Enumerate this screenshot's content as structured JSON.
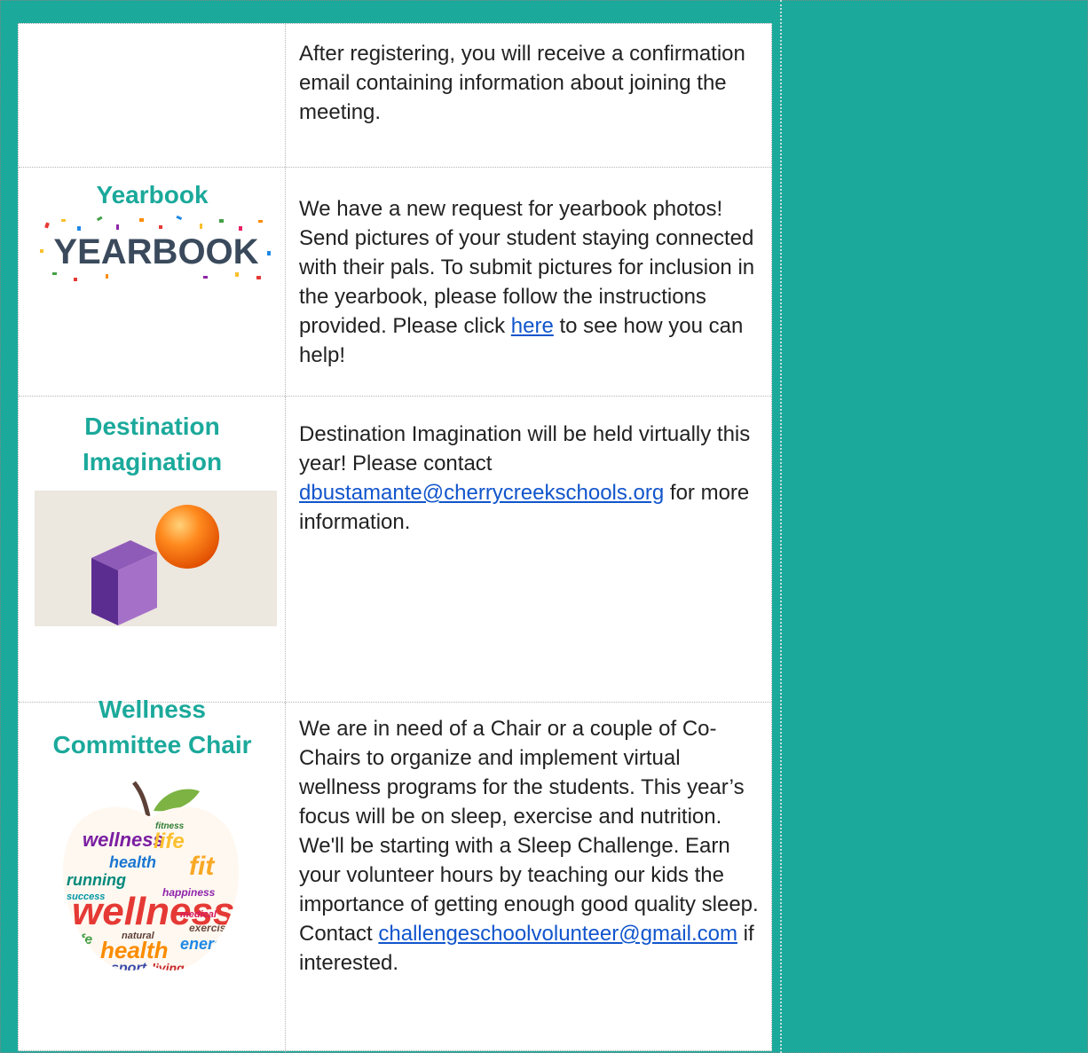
{
  "sections": {
    "intro": {
      "text": "After registering, you will receive a confirmation email containing information about joining the meeting."
    },
    "yearbook": {
      "title": "Yearbook",
      "image_text": "YEARBOOK",
      "text_before": "We have a new request for yearbook photos! Send pictures of your student staying connected with their pals. To submit pictures for inclusion in the yearbook, please follow the instructions provided. Please click ",
      "link": "here",
      "text_after": " to see how you can help!"
    },
    "destination": {
      "title_line1": "Destination",
      "title_line2": "Imagination",
      "text_before": "Destination Imagination will be held virtually this year!  Please contact ",
      "link": "dbustamante@cherrycreekschools.org",
      "text_after": " for more information."
    },
    "wellness": {
      "title_line1": "Wellness",
      "title_line2": "Committee Chair",
      "words": [
        "wellness",
        "health",
        "life",
        "fit",
        "running",
        "energy",
        "sport",
        "living",
        "exercise",
        "success",
        "natural",
        "happiness",
        "medical",
        "fitness"
      ],
      "text_before": "We are in need of a Chair or a couple of Co-Chairs to organize and implement virtual wellness programs for the students. This year’s focus will be on sleep, exercise and nutrition. We'll be starting with a Sleep Challenge. Earn your volunteer hours by teaching our kids the importance of getting enough good quality sleep. Contact ",
      "link": "challengeschoolvolunteer@gmail.com",
      "text_after": " if interested."
    }
  },
  "colors": {
    "accent": "#1ba99b",
    "link": "#1155cc"
  }
}
